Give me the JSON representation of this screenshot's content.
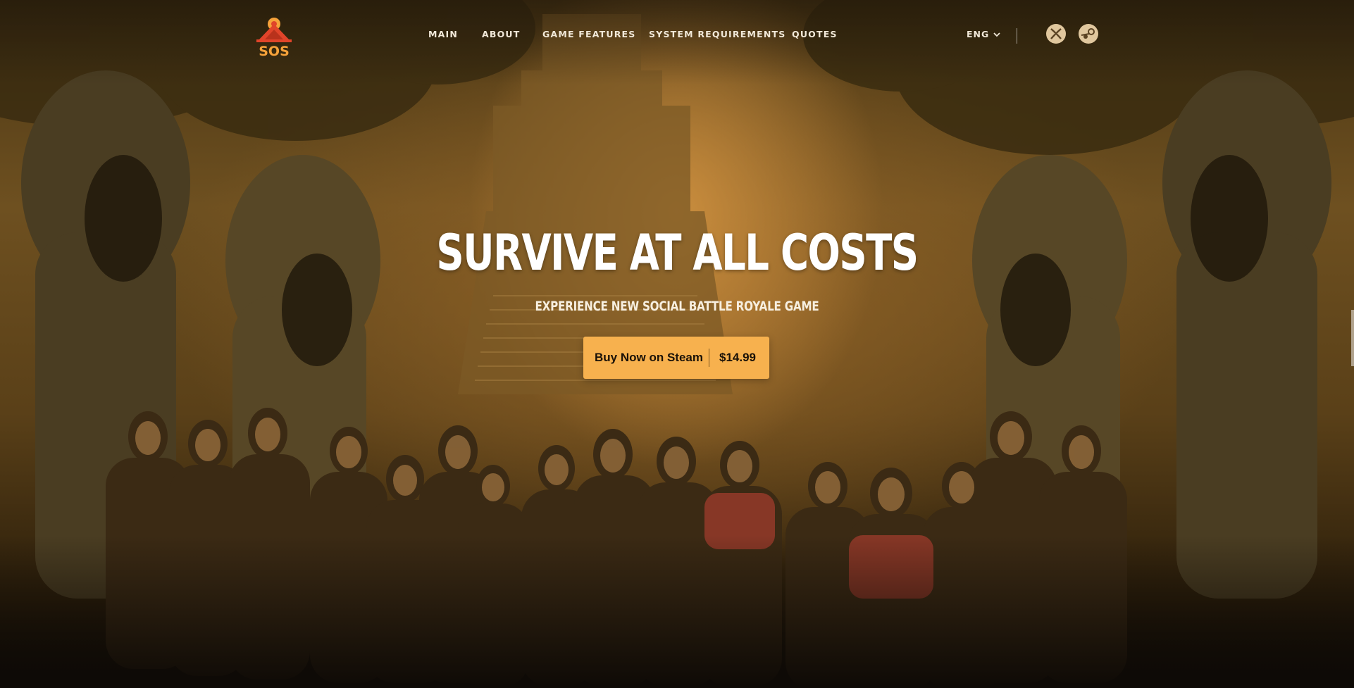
{
  "header": {
    "logo_text": "SOS",
    "nav": [
      {
        "label": "MAIN"
      },
      {
        "label": "ABOUT"
      },
      {
        "label": "GAME FEATURES"
      },
      {
        "label": "SYSTEM REQUIREMENTS"
      },
      {
        "label": "QUOTES"
      }
    ],
    "language": "ENG",
    "platform_icons": [
      "xbox-icon",
      "steam-icon"
    ]
  },
  "hero": {
    "title": "SURVIVE AT ALL COSTS",
    "subtitle": "EXPERIENCE NEW SOCIAL BATTLE ROYALE GAME",
    "buy_button": {
      "label": "Buy Now on Steam",
      "price": "$14.99"
    }
  },
  "colors": {
    "accent": "#f7b14e",
    "logo_red": "#e0442a",
    "logo_orange": "#f6a23a",
    "text_light": "#f1e8d8"
  }
}
